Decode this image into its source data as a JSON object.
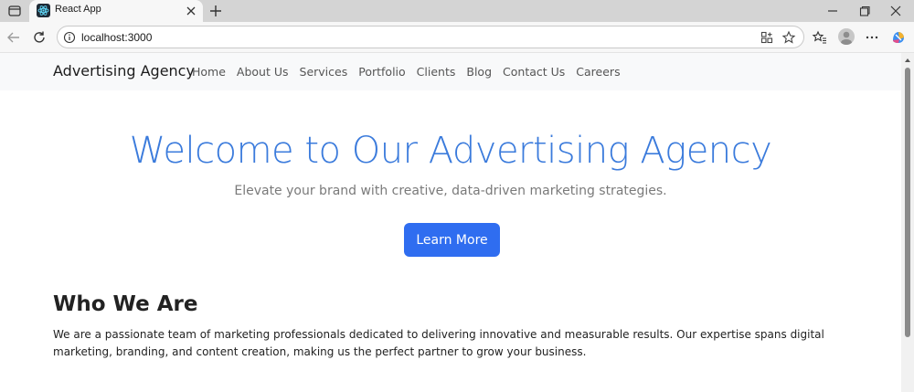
{
  "browser": {
    "tab_title": "React App",
    "url": "localhost:3000"
  },
  "navbar": {
    "brand": "Advertising Agency",
    "links": [
      "Home",
      "About Us",
      "Services",
      "Portfolio",
      "Clients",
      "Blog",
      "Contact Us",
      "Careers"
    ]
  },
  "hero": {
    "title": "Welcome to Our Advertising Agency",
    "subtitle": "Elevate your brand with creative, data-driven marketing strategies.",
    "cta_label": "Learn More"
  },
  "about": {
    "title": "Who We Are",
    "body": "We are a passionate team of marketing professionals dedicated to delivering innovative and measurable results. Our expertise spans digital marketing, branding, and content creation, making us the perfect partner to grow your business."
  },
  "colors": {
    "accent": "#3b7bdc",
    "button": "#2f6df0",
    "navbar_bg": "#f8f9fa"
  }
}
